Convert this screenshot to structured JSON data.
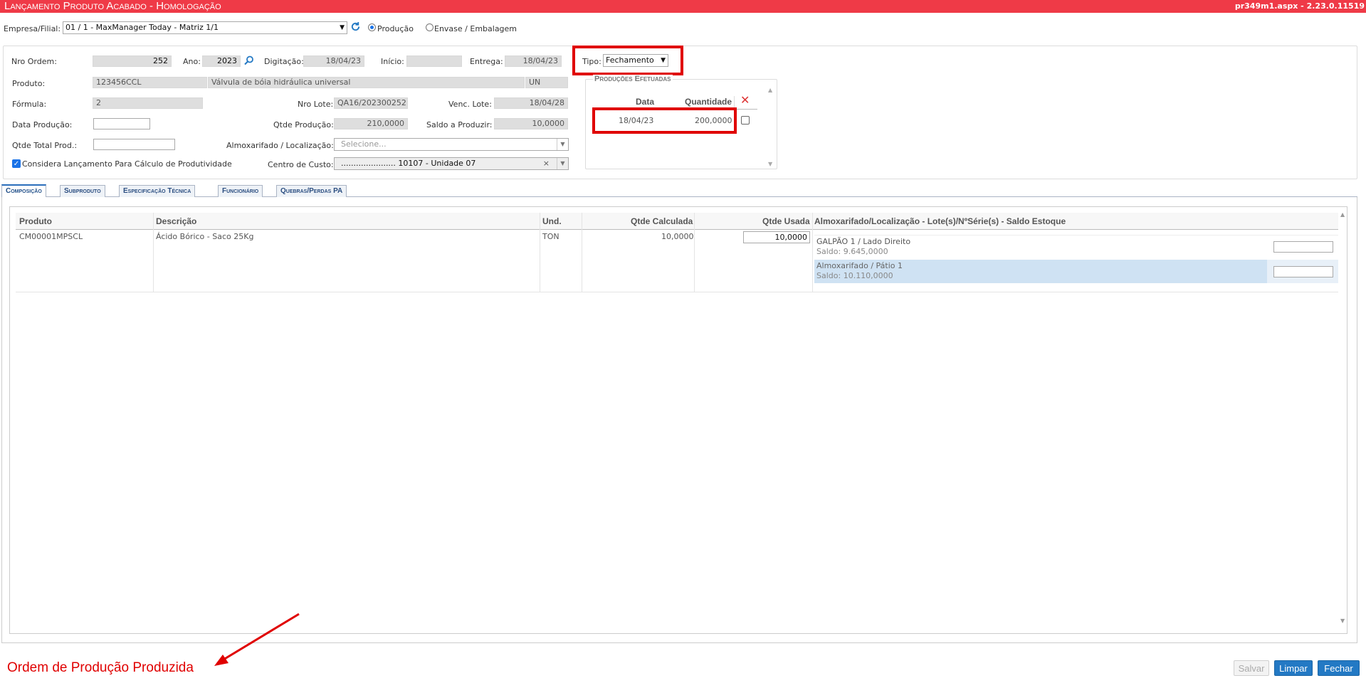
{
  "header": {
    "title": "Lançamento Produto Acabado   - Homologação",
    "version": "pr349m1.aspx - 2.23.0.11519"
  },
  "top": {
    "empresa_label": "Empresa/Filial:",
    "empresa_value": "01 / 1 - MaxManager Today - Matriz 1/1",
    "radio_producao": "Produção",
    "radio_envase": "Envase / Embalagem"
  },
  "form": {
    "nro_ordem_label": "Nro Ordem:",
    "nro_ordem_value": "252",
    "ano_label": "Ano:",
    "ano_value": "2023",
    "digitacao_label": "Digitação:",
    "digitacao_value": "18/04/23",
    "inicio_label": "Início:",
    "inicio_value": "",
    "entrega_label": "Entrega:",
    "entrega_value": "18/04/23",
    "tipo_label": "Tipo:",
    "tipo_value": "Fechamento",
    "produto_label": "Produto:",
    "produto_code": "123456CCL",
    "produto_desc": "Válvula de bóia hidráulica universal",
    "produto_un": "UN",
    "formula_label": "Fórmula:",
    "formula_value": "2",
    "nro_lote_label": "Nro Lote:",
    "nro_lote_value": "QA16/202300252",
    "venc_lote_label": "Venc. Lote:",
    "venc_lote_value": "18/04/28",
    "data_producao_label": "Data Produção:",
    "qtde_producao_label": "Qtde Produção:",
    "qtde_producao_value": "210,0000",
    "saldo_label": "Saldo a Produzir:",
    "saldo_value": "10,0000",
    "qtde_total_label": "Qtde Total Prod.:",
    "almox_label": "Almoxarifado / Localização:",
    "almox_placeholder": "Selecione...",
    "considera_label": "Considera Lançamento Para Cálculo de Produtividade",
    "centro_label": "Centro de Custo:",
    "centro_value": "...................... 10107 - Unidade 07"
  },
  "producoes": {
    "title": "Produções Efetuadas",
    "col_data": "Data",
    "col_qtd": "Quantidade",
    "rows": [
      {
        "data": "18/04/23",
        "qtd": "200,0000"
      }
    ]
  },
  "tabs": [
    "Composição",
    "Subproduto",
    "Especificação Técnica",
    "Funcionário",
    "Quebras/Perdas PA"
  ],
  "grid": {
    "headers": {
      "produto": "Produto",
      "descricao": "Descrição",
      "und": "Und.",
      "qtde_calc": "Qtde Calculada",
      "qtde_usada": "Qtde Usada",
      "almox": "Almoxarifado/Localização - Lote(s)/NºSérie(s) - Saldo Estoque"
    },
    "row": {
      "produto": "CM00001MPSCL",
      "descricao": "Ácido Bórico - Saco 25Kg",
      "und": "TON",
      "qtde_calc": "10,0000",
      "qtde_usada": "10,0000"
    },
    "locations": [
      {
        "name": "GALPÃO 1 / Lado Direito",
        "saldo": "Saldo: 9.645,0000"
      },
      {
        "name": "Almoxarifado / Pátio 1",
        "saldo": "Saldo: 10.110,0000"
      }
    ]
  },
  "footer": {
    "annotation": "Ordem de Produção Produzida",
    "salvar": "Salvar",
    "limpar": "Limpar",
    "fechar": "Fechar"
  },
  "colors": {
    "titlebar": "#ef3a47",
    "button_primary": "#2379c4",
    "highlight": "#e00000",
    "selected_row": "#cfe2f3"
  }
}
